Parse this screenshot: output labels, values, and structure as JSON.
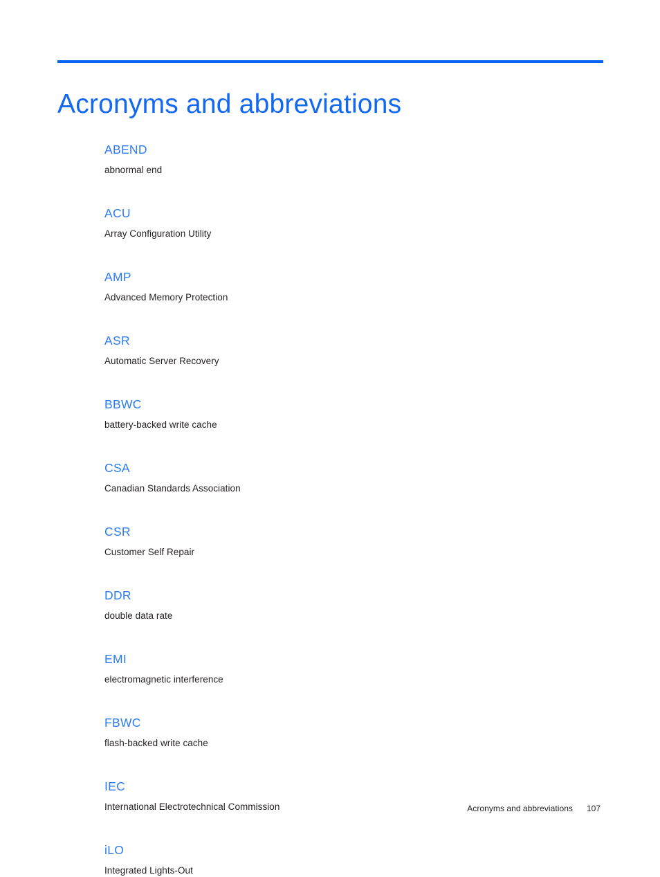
{
  "document": {
    "title": "Acronyms and abbreviations",
    "accent_rule_color": "#0a62f5",
    "title_color": "#1368f0",
    "term_color": "#2b7bf3",
    "body_color": "#231f20"
  },
  "glossary": {
    "entries": [
      {
        "term": "ABEND",
        "definition": "abnormal end"
      },
      {
        "term": "ACU",
        "definition": "Array Configuration Utility"
      },
      {
        "term": "AMP",
        "definition": "Advanced Memory Protection"
      },
      {
        "term": "ASR",
        "definition": "Automatic Server Recovery"
      },
      {
        "term": "BBWC",
        "definition": "battery-backed write cache"
      },
      {
        "term": "CSA",
        "definition": "Canadian Standards Association"
      },
      {
        "term": "CSR",
        "definition": "Customer Self Repair"
      },
      {
        "term": "DDR",
        "definition": "double data rate"
      },
      {
        "term": "EMI",
        "definition": "electromagnetic interference"
      },
      {
        "term": "FBWC",
        "definition": "flash-backed write cache"
      },
      {
        "term": "IEC",
        "definition": "International Electrotechnical Commission"
      },
      {
        "term": "iLO",
        "definition": "Integrated Lights-Out"
      }
    ]
  },
  "footer": {
    "label": "Acronyms and abbreviations",
    "page_number": "107"
  }
}
